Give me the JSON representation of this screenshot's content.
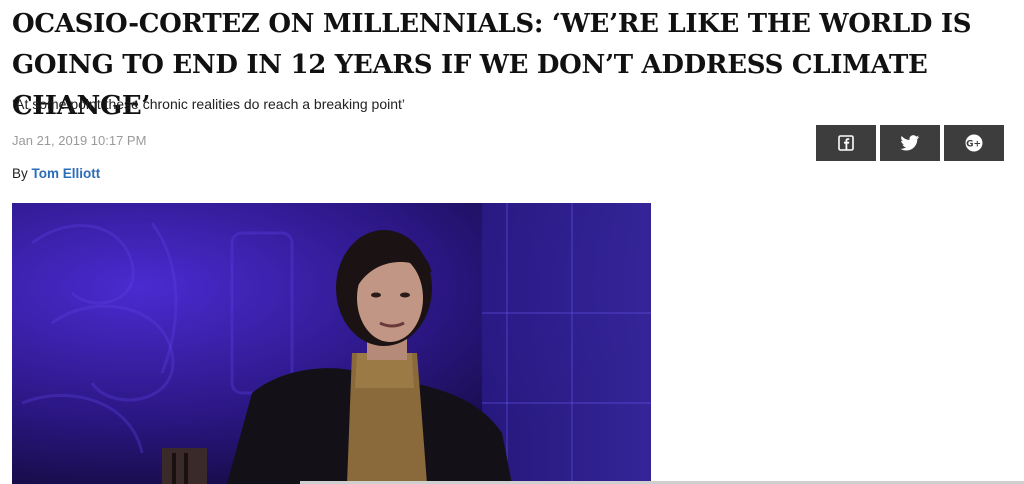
{
  "article": {
    "headline": "OCASIO-CORTEZ ON MILLENNIALS: ‘WE’RE LIKE THE WORLD IS GOING TO END IN 12 YEARS IF WE DON’T ADDRESS CLIMATE CHANGE’",
    "subheadline": "‘At some point these chronic realities do reach a breaking point’",
    "timestamp": "Jan 21, 2019 10:17 PM",
    "byline_prefix": "By",
    "author": "Tom Elliott"
  },
  "share": {
    "buttons": [
      {
        "icon": "facebook-icon"
      },
      {
        "icon": "twitter-icon"
      },
      {
        "icon": "google-plus-icon"
      }
    ],
    "button_color": "#3d3d3d"
  },
  "colors": {
    "author_link": "#2c6db8",
    "timestamp": "#9a9a9a"
  }
}
